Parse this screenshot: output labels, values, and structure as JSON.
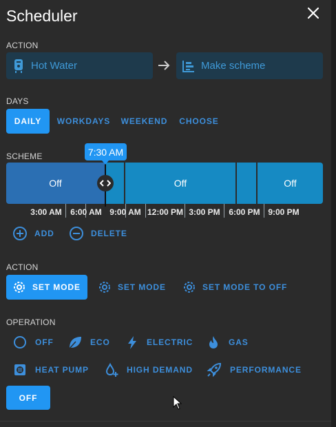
{
  "dialog": {
    "title": "Scheduler",
    "close_icon": "close-icon"
  },
  "action": {
    "label": "ACTION",
    "entity": {
      "icon": "water-heater-icon",
      "text": "Hot Water"
    },
    "arrow_icon": "arrow-right-icon",
    "service": {
      "icon": "timeline-icon",
      "text": "Make scheme"
    }
  },
  "days": {
    "label": "DAYS",
    "options": [
      "DAILY",
      "WORKDAYS",
      "WEEKEND",
      "CHOOSE"
    ],
    "selected": "DAILY"
  },
  "scheme": {
    "label": "SCHEME",
    "tooltip": "7:30 AM",
    "segments": [
      "Off",
      "",
      "Off",
      "",
      "Off"
    ],
    "time_labels": [
      "3:00 AM",
      "6:00 AM",
      "9:00 AM",
      "12:00 PM",
      "3:00 PM",
      "6:00 PM",
      "9:00 PM"
    ],
    "add_label": "ADD",
    "delete_label": "DELETE",
    "colors": {
      "selected_segment": "#2b6fb3",
      "segment": "#168ac3"
    }
  },
  "mode": {
    "label": "ACTION",
    "options": [
      "SET MODE",
      "SET MODE",
      "SET MODE TO OFF"
    ],
    "selected_index": 0
  },
  "operation": {
    "label": "OPERATION",
    "options": [
      {
        "text": "OFF",
        "icon": "circle-outline-icon"
      },
      {
        "text": "ECO",
        "icon": "leaf-icon"
      },
      {
        "text": "ELECTRIC",
        "icon": "flash-icon"
      },
      {
        "text": "GAS",
        "icon": "fire-icon"
      },
      {
        "text": "HEAT PUMP",
        "icon": "heat-pump-icon"
      },
      {
        "text": "HIGH DEMAND",
        "icon": "water-plus-icon"
      },
      {
        "text": "PERFORMANCE",
        "icon": "rocket-icon"
      }
    ],
    "selected": "OFF"
  },
  "accent": "#2196f3"
}
